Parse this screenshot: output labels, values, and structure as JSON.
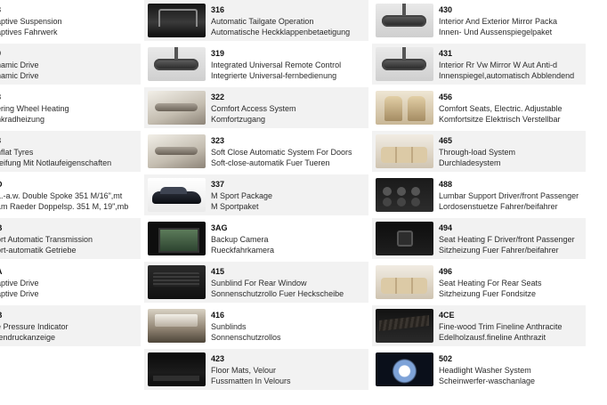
{
  "col1": [
    {
      "code": "3",
      "line1": "aptive Suspension",
      "line2": "aptives Fahrwerk",
      "shaded": false
    },
    {
      "code": "9",
      "line1": "namic Drive",
      "line2": "namic Drive",
      "shaded": true
    },
    {
      "code": "8",
      "line1": "ering Wheel Heating",
      "line2": "nkradheizung",
      "shaded": false
    },
    {
      "code": "8",
      "line1": "nflat Tyres",
      "line2": "reifung Mit Notlaufeigenschaften",
      "shaded": true
    },
    {
      "code": "D",
      "line1": "L.-a.w. Double Spoke 351 M/16\",mt",
      "line2": "Lm Raeder Doppelsp. 351 M, 19\",mb",
      "shaded": false
    },
    {
      "code": "B",
      "line1": "ort Automatic Transmission",
      "line2": "ort-automatik Getriebe",
      "shaded": true
    },
    {
      "code": "A",
      "line1": "aptive Drive",
      "line2": "aptive Drive",
      "shaded": false
    },
    {
      "code": "B",
      "line1": "e Pressure Indicator",
      "line2": "fendruckanzeige",
      "shaded": true
    }
  ],
  "col2": [
    {
      "code": "316",
      "line1": "Automatic Tailgate Operation",
      "line2": "Automatische Heckklappenbetaetigung",
      "thumb": "rear-tailgate-image",
      "style": "t-rear",
      "shaded": true
    },
    {
      "code": "319",
      "line1": "Integrated Universal Remote Control",
      "line2": "Integrierte Universal-fernbedienung",
      "thumb": "mirror-image",
      "style": "t-mirror",
      "shaded": false
    },
    {
      "code": "322",
      "line1": "Comfort Access System",
      "line2": "Komfortzugang",
      "thumb": "door-handle-image",
      "style": "t-handle",
      "shaded": true
    },
    {
      "code": "323",
      "line1": "Soft Close Automatic System For Doors",
      "line2": "Soft-close-automatik Fuer Tueren",
      "thumb": "door-handle-image",
      "style": "t-handle",
      "shaded": false
    },
    {
      "code": "337",
      "line1": "M Sport Package",
      "line2": "M Sportpaket",
      "thumb": "car-image",
      "style": "t-car",
      "shaded": true
    },
    {
      "code": "3AG",
      "line1": "Backup Camera",
      "line2": "Rueckfahrkamera",
      "thumb": "camera-screen-image",
      "style": "t-screen",
      "shaded": false
    },
    {
      "code": "415",
      "line1": "Sunblind For Rear Window",
      "line2": "Sonnenschutzrollo Fuer Heckscheibe",
      "thumb": "sunblind-image",
      "style": "t-blind",
      "shaded": true
    },
    {
      "code": "416",
      "line1": "Sunblinds",
      "line2": "Sonnenschutzrollos",
      "thumb": "interior-image",
      "style": "t-interior",
      "shaded": false
    },
    {
      "code": "423",
      "line1": "Floor Mats, Velour",
      "line2": "Fussmatten In Velours",
      "thumb": "floor-mat-image",
      "style": "t-dark",
      "shaded": true
    }
  ],
  "col3": [
    {
      "code": "430",
      "line1": "Interior And Exterior Mirror Packa",
      "line2": "Innen- Und Aussenspiegelpaket",
      "thumb": "mirror-image",
      "style": "t-mirror",
      "shaded": false
    },
    {
      "code": "431",
      "line1": "Interior Rr Vw Mirror W Aut Anti-d",
      "line2": "Innenspiegel,automatisch Abblendend",
      "thumb": "mirror-image",
      "style": "t-mirror",
      "shaded": true
    },
    {
      "code": "456",
      "line1": "Comfort Seats, Electric. Adjustable",
      "line2": "Komfortsitze Elektrisch Verstellbar",
      "thumb": "seats-image",
      "style": "t-seat",
      "shaded": false
    },
    {
      "code": "465",
      "line1": "Through-load System",
      "line2": "Durchladesystem",
      "thumb": "rear-seat-image",
      "style": "t-rearseat",
      "shaded": true
    },
    {
      "code": "488",
      "line1": "Lumbar Support Driver/front Passenger",
      "line2": "Lordosenstuetze Fahrer/beifahrer",
      "thumb": "seat-controls-image",
      "style": "t-console",
      "shaded": false
    },
    {
      "code": "494",
      "line1": "Seat Heating F Driver/front Passenger",
      "line2": "Sitzheizung Fuer Fahrer/beifahrer",
      "thumb": "heat-button-image",
      "style": "t-btn",
      "shaded": true
    },
    {
      "code": "496",
      "line1": "Seat Heating For Rear Seats",
      "line2": "Sitzheizung Fuer Fondsitze",
      "thumb": "rear-seat-image",
      "style": "t-rearseat",
      "shaded": false
    },
    {
      "code": "4CE",
      "line1": "Fine-wood Trim Fineline Anthracite",
      "line2": "Edelholzausf.fineline Anthrazit",
      "thumb": "wood-trim-image",
      "style": "t-wood",
      "shaded": true
    },
    {
      "code": "502",
      "line1": "Headlight Washer System",
      "line2": "Scheinwerfer-waschanlage",
      "thumb": "headlight-image",
      "style": "t-light",
      "shaded": false
    }
  ]
}
